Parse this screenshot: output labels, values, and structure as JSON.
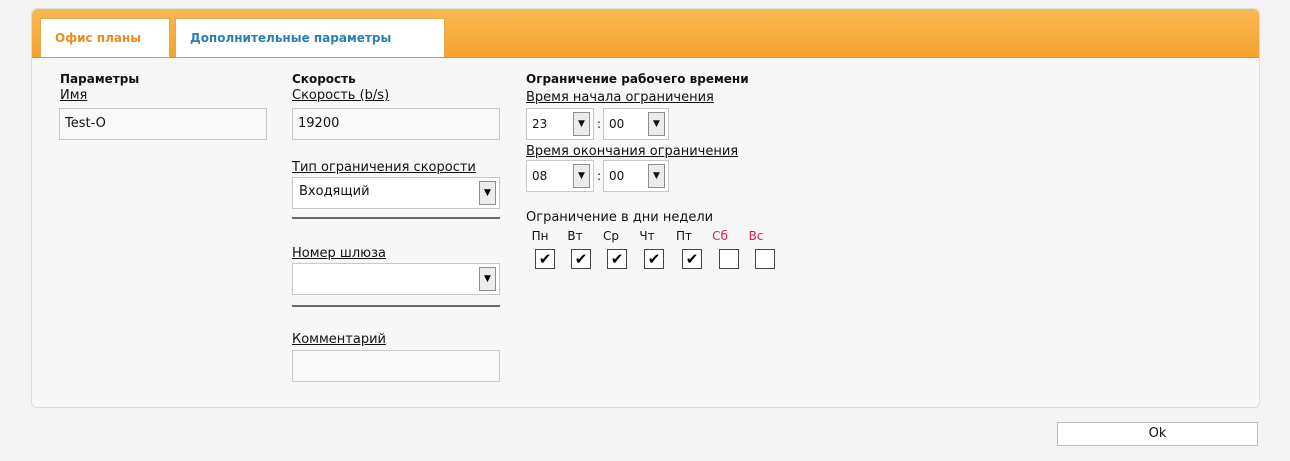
{
  "tabs": [
    {
      "label": "Офис планы",
      "active": true
    },
    {
      "label": "Дополнительные параметры",
      "active": false
    }
  ],
  "params": {
    "heading": "Параметры",
    "name_label": "Имя",
    "name_value": "Test-O"
  },
  "speed": {
    "heading": "Скорость",
    "speed_label": "Скорость (b/s)",
    "speed_value": "19200",
    "limit_type_label": "Тип ограничения скорости",
    "limit_type_value": "Входящий",
    "gateway_label": "Номер шлюза",
    "gateway_value": "",
    "comment_label": "Комментарий",
    "comment_value": ""
  },
  "worktime": {
    "heading": "Ограничение рабочего времени",
    "start_label": "Время начала ограничения",
    "start_hour": "23",
    "start_min": "00",
    "end_label": "Время окончания ограничения",
    "end_hour": "08",
    "end_min": "00",
    "sep": ":",
    "days_label": "Ограничение в дни недели",
    "days": [
      {
        "label": "Пн",
        "checked": true,
        "weekend": false
      },
      {
        "label": "Вт",
        "checked": true,
        "weekend": false
      },
      {
        "label": "Ср",
        "checked": true,
        "weekend": false
      },
      {
        "label": "Чт",
        "checked": true,
        "weekend": false
      },
      {
        "label": "Пт",
        "checked": true,
        "weekend": false
      },
      {
        "label": "Сб",
        "checked": false,
        "weekend": true
      },
      {
        "label": "Вс",
        "checked": false,
        "weekend": true
      }
    ],
    "check_glyph": "✔"
  },
  "ok_label": "Ok",
  "dropdown_glyph": "▼",
  "colors": {
    "tab_orange": "#f6a22f",
    "active_tab_text": "#e8901b",
    "inactive_tab_text": "#2b7fb5",
    "weekend": "#e0204a"
  }
}
